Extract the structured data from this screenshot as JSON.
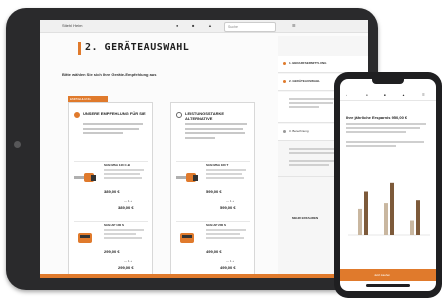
{
  "tablet": {
    "topbar": {
      "brand": "Stiehl Heim",
      "icons": [
        "search-icon",
        "user-icon",
        "cart-icon",
        "menu-icon"
      ],
      "search_placeholder": "Suche"
    },
    "page_title": "2. GERÄTEAUSWAHL",
    "subtitle": "Bitte wählen Sie sich Ihre Geräte-Empfehlung aus",
    "section_label": "EMPFEHLUNG",
    "columns": [
      {
        "heading": "UNSERE EMPFEHLUNG FÜR SIE",
        "products": [
          {
            "title": "Stihl MSA 140 C-B",
            "price": "389,00 €",
            "total": "389,00 €"
          },
          {
            "title": "Stihl AP 100 S",
            "price": "299,00 €",
            "total": "299,00 €"
          }
        ]
      },
      {
        "heading": "LEISTUNGSSTARKE ALTERNATIVE",
        "products": [
          {
            "title": "Stihl MSA 160 T",
            "price": "599,00 €",
            "total": "599,00 €"
          },
          {
            "title": "Stihl AP 200 S",
            "price": "499,00 €",
            "total": "499,00 €"
          }
        ]
      }
    ],
    "sidebar_steps": [
      {
        "label": "1. BEDARFSERMITTLUNG"
      },
      {
        "label": "2. GERÄTEAUSWAHL"
      },
      {
        "label": "3. Berechnung"
      }
    ],
    "sidebar_link": "MEHR ERFAHREN"
  },
  "phone": {
    "title": "Ihre jährliche Ersparnis 950,00 €",
    "bottom_left": "Jetzt kaufen",
    "chart_bars": [
      0.45,
      0.75,
      0.55,
      0.9,
      0.25,
      0.6
    ],
    "colors": {
      "accent": "#e07a2c",
      "bar_light": "#c9b7a0",
      "bar_dark": "#7d5a3a"
    }
  }
}
